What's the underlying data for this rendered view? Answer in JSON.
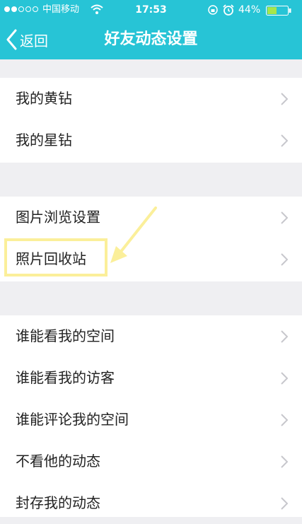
{
  "status_bar": {
    "carrier": "中国移动",
    "time": "17:53",
    "battery_percent": "44%"
  },
  "nav": {
    "back_label": "返回",
    "title": "好友动态设置"
  },
  "sections": [
    {
      "items": [
        "我的黄钻",
        "我的星钻"
      ]
    },
    {
      "items": [
        "图片浏览设置",
        "照片回收站"
      ]
    },
    {
      "items": [
        "谁能看我的空间",
        "谁能看我的访客",
        "谁能评论我的空间",
        "不看他的动态",
        "封存我的动态"
      ]
    }
  ],
  "colors": {
    "header_bg": "#27c4d6",
    "highlight": "#fbef9a"
  },
  "icons": [
    "back-chevron-icon",
    "chevron-right-icon",
    "wifi-icon",
    "lock-rotation-icon",
    "alarm-icon",
    "battery-icon"
  ]
}
